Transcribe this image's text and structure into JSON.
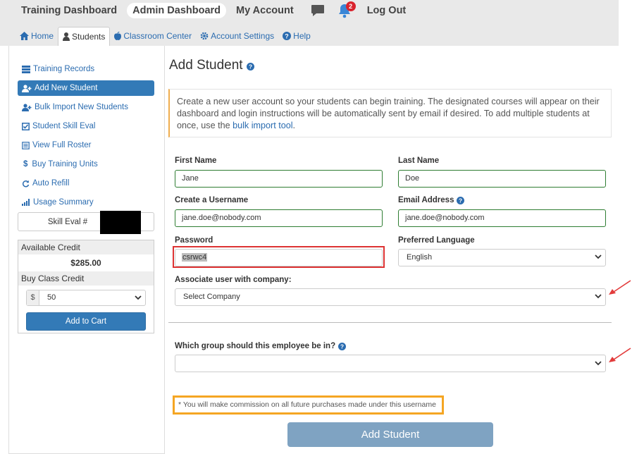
{
  "topnav": {
    "items": [
      "Training Dashboard",
      "Admin Dashboard",
      "My Account"
    ],
    "logout": "Log Out",
    "notification_count": "2"
  },
  "subnav": {
    "tabs": [
      "Home",
      "Students",
      "Classroom Center",
      "Account Settings",
      "Help"
    ]
  },
  "sidebar": {
    "items": [
      "Training Records",
      "Add New Student",
      "Bulk Import New Students",
      "Student Skill Eval",
      "View Full Roster",
      "Buy Training Units",
      "Auto Refill",
      "Usage Summary"
    ],
    "skill_eval_label": "Skill Eval #",
    "available_credit_label": "Available Credit",
    "available_credit_value": "$285.00",
    "buy_class_credit_label": "Buy Class Credit",
    "currency_symbol": "$",
    "quantity_value": "50",
    "add_to_cart": "Add to Cart"
  },
  "main": {
    "title": "Add Student",
    "info_text": "Create a new user account so your students can begin training. The designated courses will appear on their dashboard and login instructions will be automatically sent by email if desired. To add multiple students at once, use the ",
    "info_link": "bulk import tool",
    "info_end": ".",
    "fields": {
      "first_name_label": "First Name",
      "first_name_value": "Jane",
      "last_name_label": "Last Name",
      "last_name_value": "Doe",
      "username_label": "Create a Username",
      "username_value": "jane.doe@nobody.com",
      "email_label": "Email Address",
      "email_value": "jane.doe@nobody.com",
      "password_label": "Password",
      "password_value": "csrwc4",
      "language_label": "Preferred Language",
      "language_value": "English",
      "company_label": "Associate user with company:",
      "company_value": "Select Company",
      "group_label": "Which group should this employee be in?",
      "group_value": ""
    },
    "commission_note": "* You will make commission on all future purchases made under this username",
    "submit": "Add Student"
  },
  "colors": {
    "primary": "#337ab7",
    "highlight_red": "#dd3333",
    "highlight_orange": "#f5a623",
    "valid_green": "#2e7d32"
  }
}
